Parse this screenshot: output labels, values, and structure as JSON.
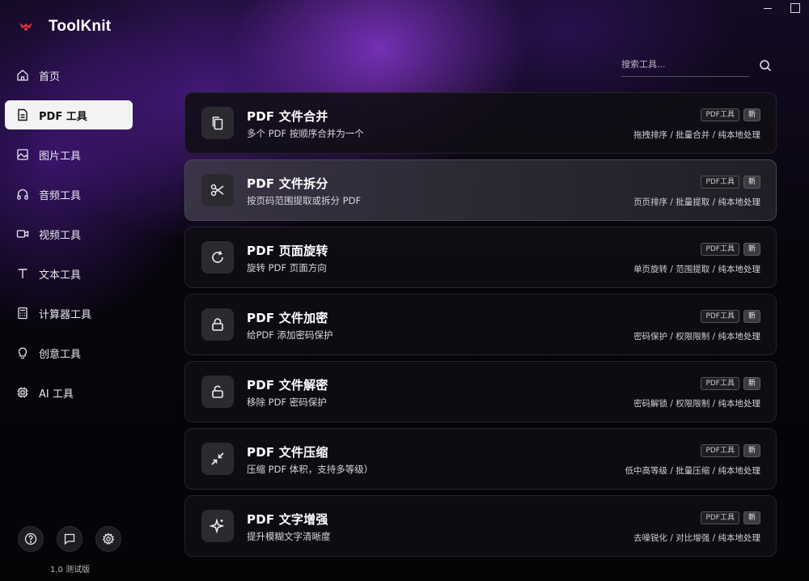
{
  "app": {
    "name": "ToolKnit",
    "version": "1.0 测试版",
    "accent": "#7b2cd6"
  },
  "window_controls": [
    "minimize",
    "maximize"
  ],
  "sidebar": {
    "items": [
      {
        "label": "首页",
        "icon": "home-icon",
        "active": false
      },
      {
        "label": "PDF 工具",
        "icon": "document-icon",
        "active": true
      },
      {
        "label": "图片工具",
        "icon": "image-icon",
        "active": false
      },
      {
        "label": "音频工具",
        "icon": "headphones-icon",
        "active": false
      },
      {
        "label": "视频工具",
        "icon": "video-icon",
        "active": false
      },
      {
        "label": "文本工具",
        "icon": "text-icon",
        "active": false
      },
      {
        "label": "计算器工具",
        "icon": "calculator-icon",
        "active": false
      },
      {
        "label": "创意工具",
        "icon": "lightbulb-icon",
        "active": false
      },
      {
        "label": "AI 工具",
        "icon": "chip-icon",
        "active": false
      }
    ],
    "bottom_buttons": [
      "help-icon",
      "feedback-icon",
      "settings-icon"
    ]
  },
  "search": {
    "placeholder": "搜索工具..."
  },
  "tools": [
    {
      "title": "PDF 文件合并",
      "desc": "多个 PDF 按顺序合并为一个",
      "badge": "PDF工具",
      "new_badge": "新",
      "tags": "拖拽排序 / 批量合并 / 纯本地处理",
      "icon": "copy-icon",
      "highlight": false
    },
    {
      "title": "PDF 文件拆分",
      "desc": "按页码范围提取或拆分 PDF",
      "badge": "PDF工具",
      "new_badge": "新",
      "tags": "页页排序 / 批量提取 / 纯本地处理",
      "icon": "scissors-icon",
      "highlight": true
    },
    {
      "title": "PDF 页面旋转",
      "desc": "旋转 PDF 页面方向",
      "badge": "PDF工具",
      "new_badge": "新",
      "tags": "单页旋转 / 范围提取 / 纯本地处理",
      "icon": "rotate-icon",
      "highlight": false
    },
    {
      "title": "PDF 文件加密",
      "desc": "给PDF 添加密码保护",
      "badge": "PDF工具",
      "new_badge": "新",
      "tags": "密码保护 / 权限限制 / 纯本地处理",
      "icon": "lock-icon",
      "highlight": false
    },
    {
      "title": "PDF 文件解密",
      "desc": "移除 PDF 密码保护",
      "badge": "PDF工具",
      "new_badge": "新",
      "tags": "密码解锁 / 权限限制 / 纯本地处理",
      "icon": "unlock-icon",
      "highlight": false
    },
    {
      "title": "PDF 文件压缩",
      "desc": "压缩 PDF 体积，支持多等级）",
      "badge": "PDF工具",
      "new_badge": "新",
      "tags": "低中高等级 / 批量压缩 / 纯本地处理",
      "icon": "compress-icon",
      "highlight": false
    },
    {
      "title": "PDF 文字增强",
      "desc": "提升模糊文字清晰度",
      "badge": "PDF工具",
      "new_badge": "新",
      "tags": "去噪锐化 / 对比增强 / 纯本地处理",
      "icon": "sparkle-icon",
      "highlight": false
    }
  ]
}
